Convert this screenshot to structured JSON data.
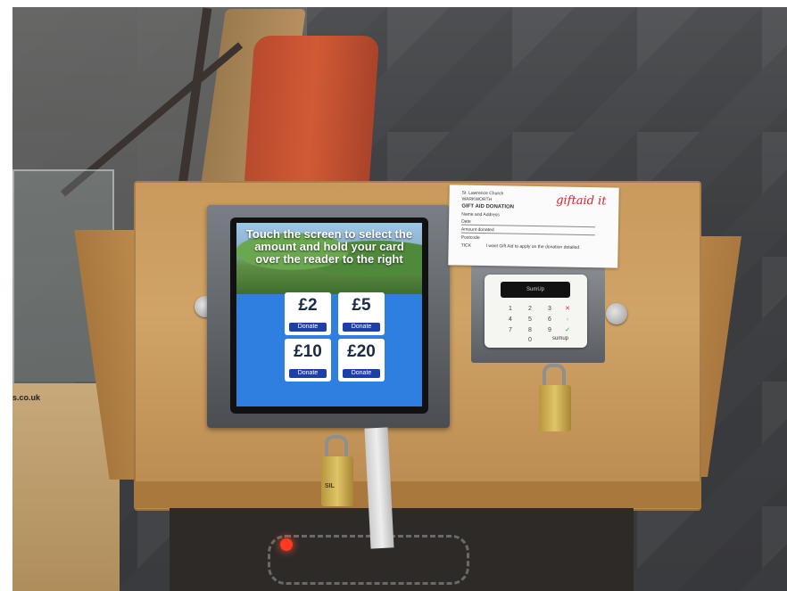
{
  "screen": {
    "message": "Touch the screen to select the amount and hold your card over the reader to the right",
    "donation_options": [
      {
        "amount": "£2",
        "button": "Donate"
      },
      {
        "amount": "£5",
        "button": "Donate"
      },
      {
        "amount": "£10",
        "button": "Donate"
      },
      {
        "amount": "£20",
        "button": "Donate"
      }
    ]
  },
  "card_reader": {
    "display": "SumUp",
    "brand": "sumup",
    "keys": [
      "1",
      "2",
      "3",
      "4",
      "5",
      "6",
      "7",
      "8",
      "9",
      "0"
    ]
  },
  "gift_aid_card": {
    "church": "St. Lawrence Church",
    "town": "WARKWORTH",
    "title": "GIFT AID DONATION",
    "brand": "giftaid it",
    "lines": [
      "Name and Address",
      "Date",
      "Amount donated",
      "Postcode",
      "TICK",
      "I want Gift Aid to apply on the donation detailed"
    ]
  },
  "padlock": {
    "label": "SIL"
  },
  "sign": {
    "text": "s.co.uk"
  }
}
